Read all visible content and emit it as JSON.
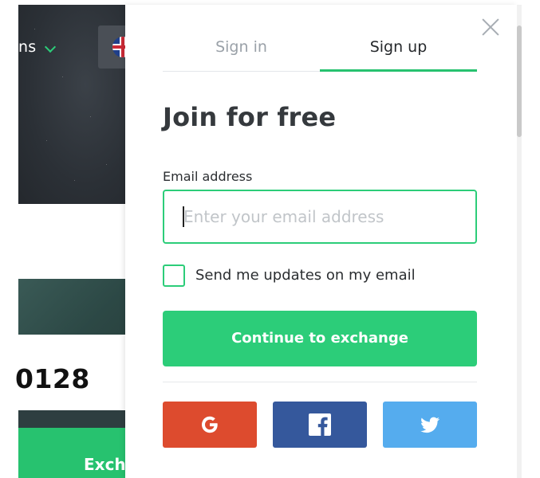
{
  "background": {
    "nav_fragment": "ns",
    "account_number_fragment": "0128",
    "green_button_fragment": "Exch"
  },
  "modal": {
    "tabs": [
      {
        "label": "Sign in",
        "active": false
      },
      {
        "label": "Sign up",
        "active": true
      }
    ],
    "title": "Join for free",
    "email": {
      "label": "Email address",
      "placeholder": "Enter your email address",
      "value": ""
    },
    "updates_checkbox": {
      "label": "Send me updates on my email",
      "checked": false
    },
    "continue_button": "Continue to exchange",
    "social_buttons": [
      {
        "provider": "google",
        "icon": "google-icon",
        "color": "#dd4b2e"
      },
      {
        "provider": "facebook",
        "icon": "facebook-icon",
        "color": "#35589c"
      },
      {
        "provider": "twitter",
        "icon": "twitter-icon",
        "color": "#55acee"
      }
    ]
  },
  "colors": {
    "accent": "#2ccd79",
    "title_text": "#35393d",
    "inactive_tab": "#9aa1a8"
  }
}
